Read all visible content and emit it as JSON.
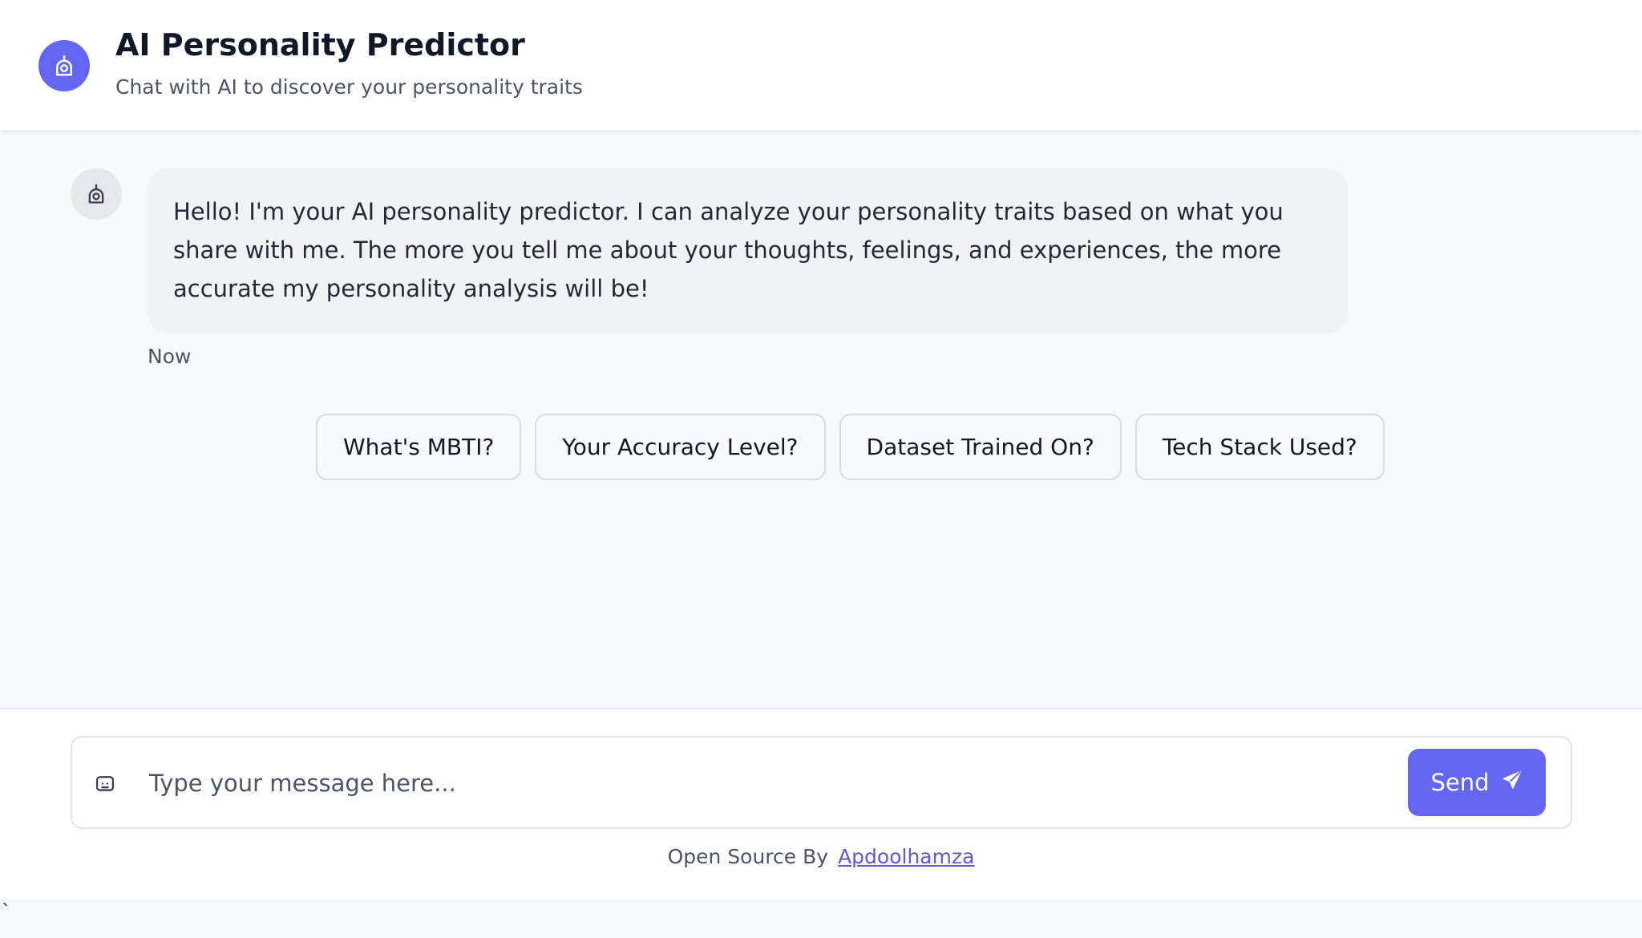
{
  "header": {
    "avatar_icon": "robot-icon",
    "title": "AI Personality Predictor",
    "subtitle": "Chat with AI to discover your personality traits"
  },
  "chat": {
    "messages": [
      {
        "sender": "bot",
        "avatar_icon": "robot-icon",
        "text": "Hello! I'm your AI personality predictor. I can analyze your personality traits based on what you share with me. The more you tell me about your thoughts, feelings, and experiences, the more accurate my personality analysis will be!",
        "time": "Now"
      }
    ],
    "suggestions": [
      {
        "label": "What's MBTI?"
      },
      {
        "label": "Your Accuracy Level?"
      },
      {
        "label": "Dataset Trained On?"
      },
      {
        "label": "Tech Stack Used?"
      }
    ]
  },
  "composer": {
    "icon": "chat-bubble-icon",
    "placeholder": "Type your message here...",
    "value": "",
    "send_label": "Send",
    "send_icon": "paper-plane-icon"
  },
  "footer": {
    "credit_prefix": "Open Source By",
    "credit_link": "Apdoolhamza",
    "stray_char": "`"
  },
  "colors": {
    "accent": "#6366f1",
    "background": "#f8f9fb",
    "bubble": "#f1f2f4",
    "text": "#111827",
    "muted": "#4b5563"
  }
}
